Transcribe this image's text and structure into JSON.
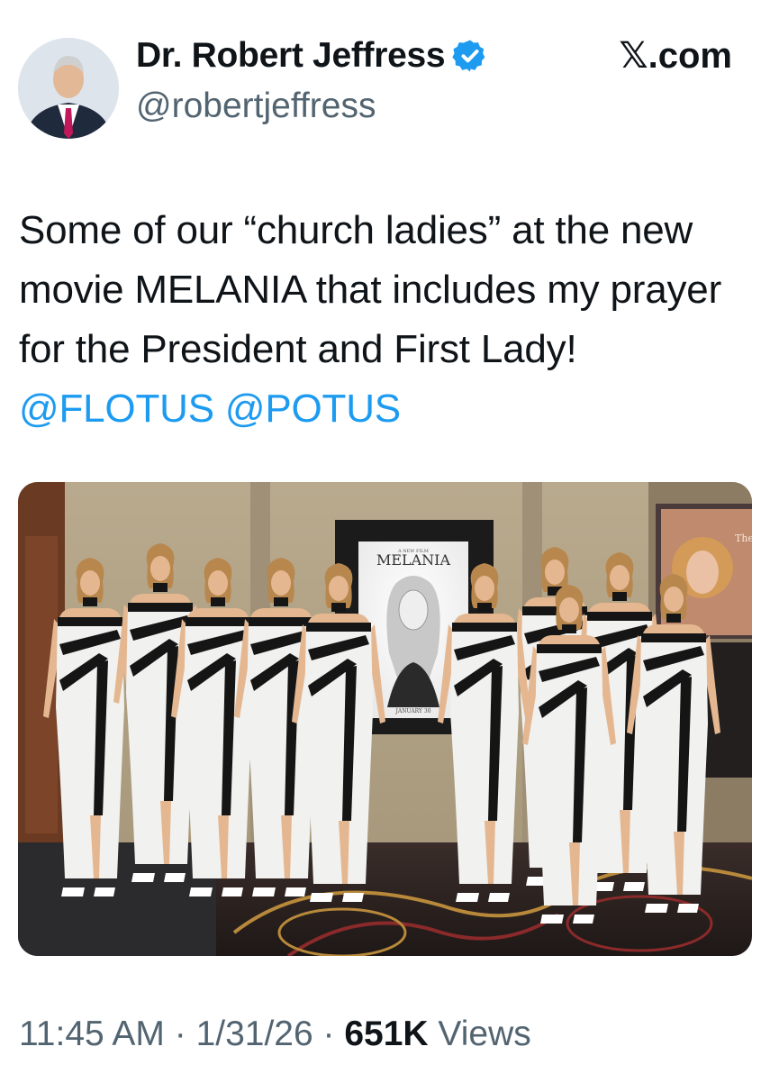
{
  "author": {
    "display_name": "Dr. Robert Jeffress",
    "handle": "@robertjeffress",
    "verified": true,
    "avatar_icon": "profile-photo",
    "verified_icon": "verified-badge-icon"
  },
  "site": {
    "icon": "x-logo-icon",
    "glyph": "𝕏",
    "label": ".com"
  },
  "tweet": {
    "text_before": "Some of our “church ladies” at the new movie MELANIA that includes my prayer for the President and First Lady! ",
    "mentions": [
      "@FLOTUS",
      "@POTUS"
    ],
    "mention_separator": " "
  },
  "media": {
    "poster_small_text": "A NEW FILM",
    "poster_title": "MELANIA",
    "poster_date": "JANUARY 30",
    "corner_poster_text": "The"
  },
  "meta": {
    "time": "11:45 AM",
    "sep1": " · ",
    "date": "1/31/26",
    "sep2": " · ",
    "views_count": "651K",
    "views_label": " Views"
  },
  "colors": {
    "text": "#0f1419",
    "secondary": "#536471",
    "link": "#1d9bf0",
    "verified": "#1d9bf0"
  }
}
